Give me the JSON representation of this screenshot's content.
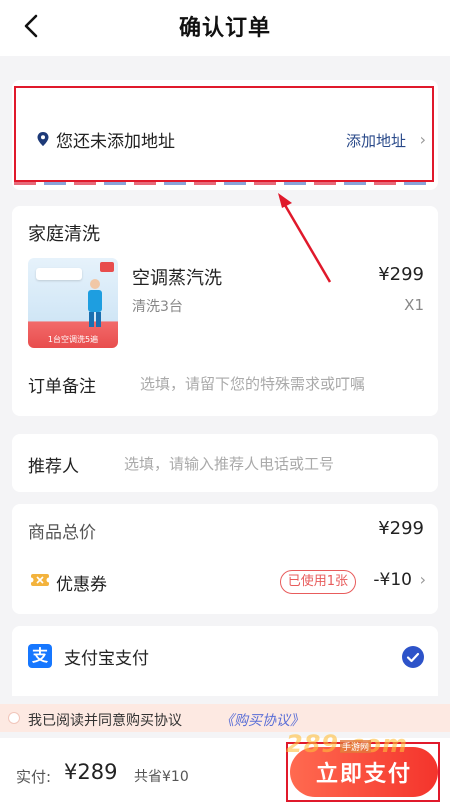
{
  "header": {
    "title": "确认订单",
    "back_icon": "chevron-left-icon"
  },
  "address": {
    "empty_text": "您还未添加地址",
    "add_label": "添加地址",
    "chevron": "›"
  },
  "order": {
    "section_title": "家庭清洗",
    "product": {
      "name": "空调蒸汽洗",
      "spec": "清洗3台",
      "price": "¥299",
      "qty": "X1",
      "thumb_caption": "1台空调洗5遍"
    },
    "remark": {
      "label": "订单备注",
      "placeholder": "选填，请留下您的特殊需求或叮嘱"
    }
  },
  "referrer": {
    "label": "推荐人",
    "placeholder": "选填，请输入推荐人电话或工号"
  },
  "summary": {
    "total_label": "商品总价",
    "total_value": "¥299",
    "coupon_label": "优惠券",
    "coupon_badge": "已使用1张",
    "coupon_value": "-¥10",
    "chevron": "›"
  },
  "payment": {
    "method_label": "支付宝支付",
    "method_icon_text": "支",
    "selected": true
  },
  "agreement": {
    "text": "我已阅读并同意购买协议",
    "link": "《购买协议》"
  },
  "bottom": {
    "pay_label": "实付:",
    "pay_amount": "¥289",
    "save_text": "共省¥10",
    "pay_button": "立即支付"
  },
  "watermark": {
    "text": "289",
    "suffix": ".com",
    "tag": "手游网"
  },
  "colors": {
    "accent_red": "#f4342c",
    "link_blue": "#2a4a8a",
    "highlight_red": "#e0192b",
    "check_blue": "#2d53c9"
  }
}
